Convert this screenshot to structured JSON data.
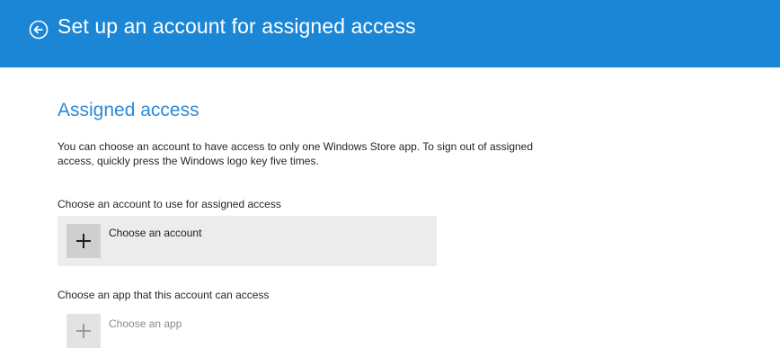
{
  "header": {
    "title": "Set up an account for assigned access",
    "back_icon": "back-arrow-circle-icon",
    "background": "#1b86d6"
  },
  "section": {
    "title": "Assigned access",
    "title_color": "#2b8ad8",
    "description": "You can choose an account to have access to only one Windows Store app. To sign out of assigned access, quickly press the Windows logo key five times."
  },
  "account": {
    "label": "Choose an account to use for assigned access",
    "button_label": "Choose an account",
    "icon": "plus-icon"
  },
  "app": {
    "label": "Choose an app that this account can access",
    "button_label": "Choose an app",
    "icon": "plus-icon",
    "enabled": false
  }
}
